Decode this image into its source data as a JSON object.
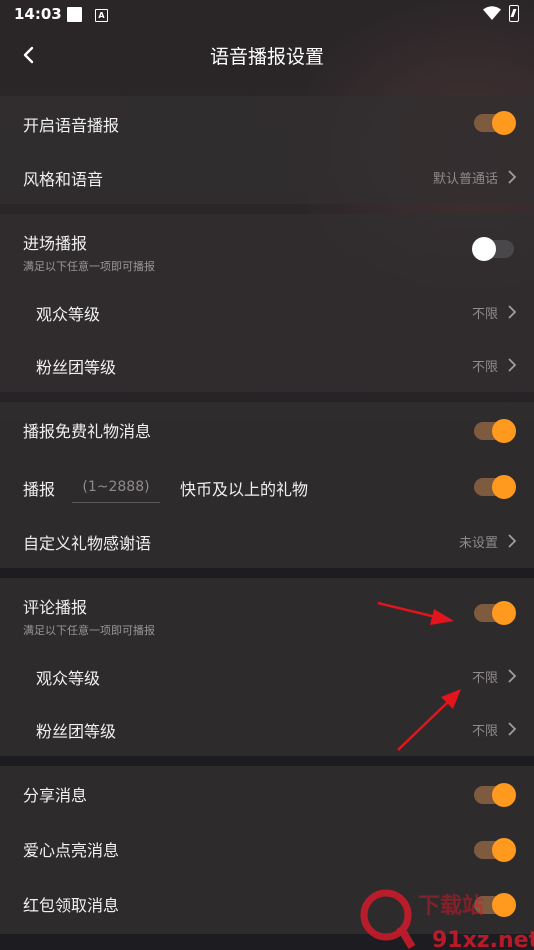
{
  "status_bar": {
    "time": "14:03",
    "badge_letter": "A"
  },
  "header": {
    "title": "语音播报设置"
  },
  "sections": {
    "s1": {
      "enable": {
        "label": "开启语音播报",
        "on": true
      },
      "style": {
        "label": "风格和语音",
        "value": "默认普通话"
      }
    },
    "s2": {
      "entry": {
        "label": "进场播报",
        "desc": "满足以下任意一项即可播报",
        "on": false
      },
      "audience_level": {
        "label": "观众等级",
        "value": "不限"
      },
      "fan_level": {
        "label": "粉丝团等级",
        "value": "不限"
      }
    },
    "s3": {
      "free_gift": {
        "label": "播报免费礼物消息",
        "on": true
      },
      "gift_threshold": {
        "prefix": "播报",
        "placeholder": "(1~2888)",
        "suffix": "快币及以上的礼物",
        "on": true
      },
      "thanks": {
        "label": "自定义礼物感谢语",
        "value": "未设置"
      }
    },
    "s4": {
      "comment": {
        "label": "评论播报",
        "desc": "满足以下任意一项即可播报",
        "on": true
      },
      "audience_level": {
        "label": "观众等级",
        "value": "不限"
      },
      "fan_level": {
        "label": "粉丝团等级",
        "value": "不限"
      }
    },
    "s5": {
      "share": {
        "label": "分享消息",
        "on": true
      },
      "like": {
        "label": "爱心点亮消息",
        "on": true
      },
      "red_packet": {
        "label": "红包领取消息",
        "on": true
      }
    }
  },
  "watermark": {
    "text": "91xz.net",
    "brand": "下载站"
  },
  "colors": {
    "accent": "#ff9a1f",
    "arrow": "#e3141c",
    "background": "#1d1c20"
  }
}
